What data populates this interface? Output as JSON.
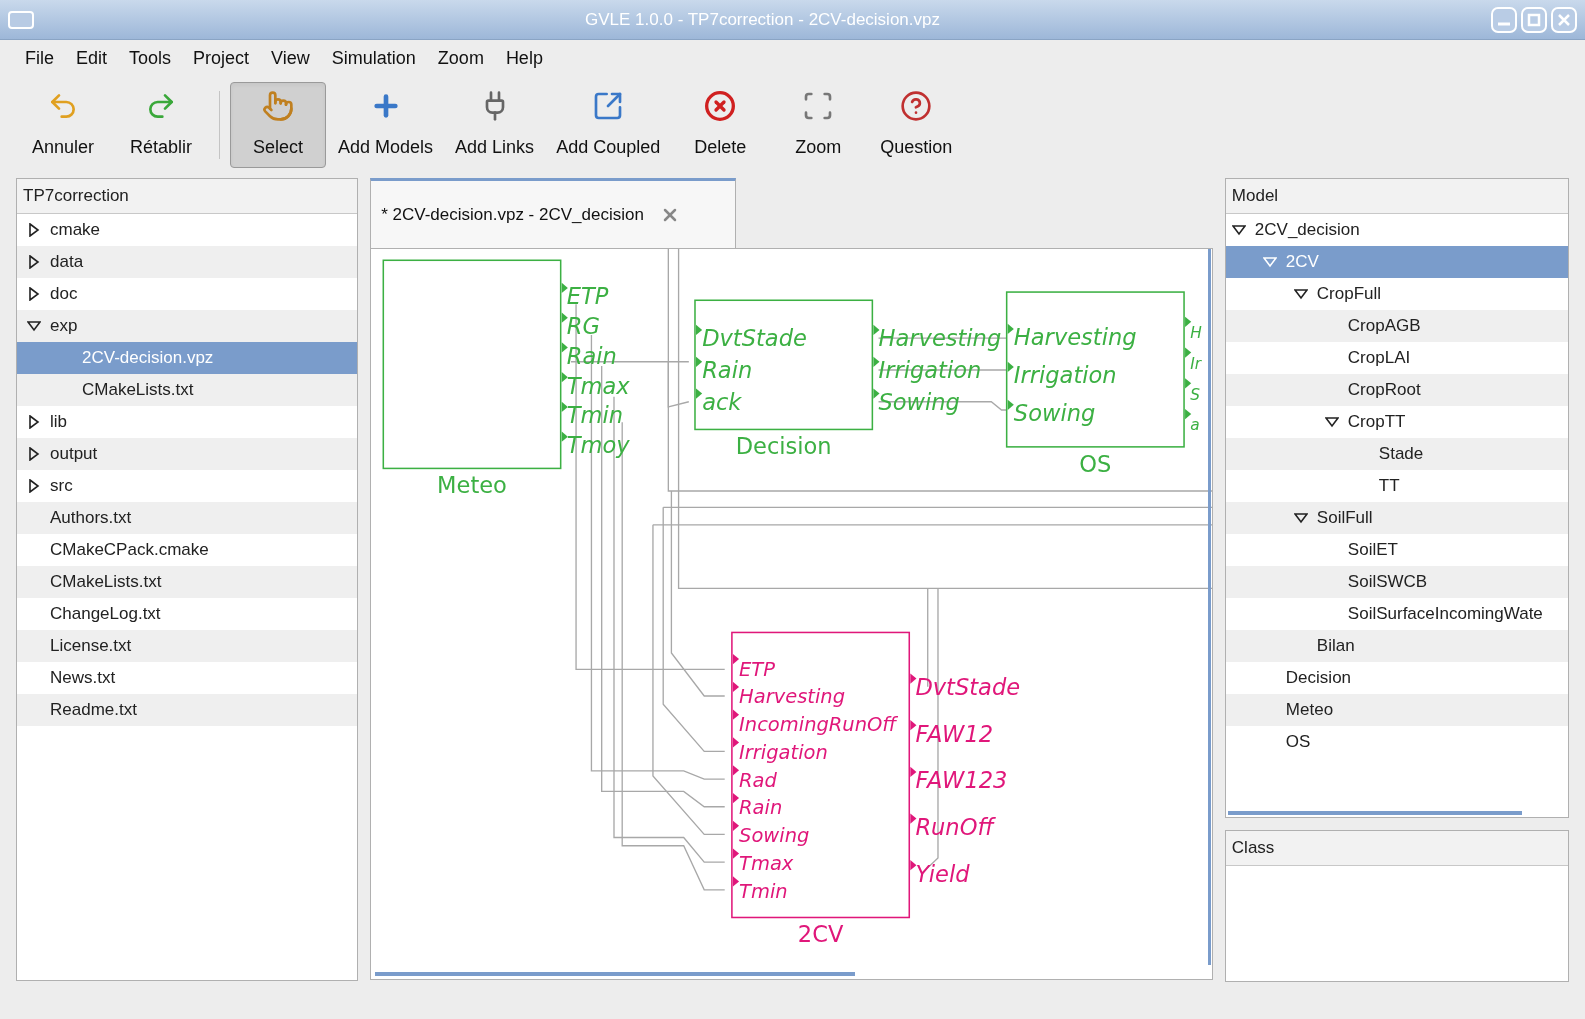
{
  "window": {
    "title": "GVLE 1.0.0 - TP7correction - 2CV-decision.vpz"
  },
  "menu": [
    {
      "label": "File"
    },
    {
      "label": "Edit"
    },
    {
      "label": "Tools"
    },
    {
      "label": "Project"
    },
    {
      "label": "View"
    },
    {
      "label": "Simulation"
    },
    {
      "label": "Zoom"
    },
    {
      "label": "Help"
    }
  ],
  "toolbar": [
    {
      "label": "Annuler",
      "kind": "undo",
      "selected": false
    },
    {
      "label": "Rétablir",
      "kind": "redo",
      "selected": false
    },
    {
      "label": "Select",
      "kind": "select",
      "selected": true
    },
    {
      "label": "Add Models",
      "kind": "add",
      "selected": false
    },
    {
      "label": "Add Links",
      "kind": "plug",
      "selected": false
    },
    {
      "label": "Add Coupled",
      "kind": "coupled",
      "selected": false
    },
    {
      "label": "Delete",
      "kind": "delete",
      "selected": false
    },
    {
      "label": "Zoom",
      "kind": "zoom",
      "selected": false
    },
    {
      "label": "Question",
      "kind": "question",
      "selected": false
    }
  ],
  "project_tree": {
    "title": "TP7correction",
    "items": [
      {
        "label": "cmake",
        "expanded": false,
        "selected": false
      },
      {
        "label": "data",
        "expanded": false,
        "selected": false
      },
      {
        "label": "doc",
        "expanded": false,
        "selected": false
      },
      {
        "label": "exp",
        "expanded": true,
        "selected": false,
        "children": [
          {
            "label": "2CV-decision.vpz",
            "selected": true
          },
          {
            "label": "CMakeLists.txt",
            "selected": false
          }
        ]
      },
      {
        "label": "lib",
        "expanded": false,
        "selected": false
      },
      {
        "label": "output",
        "expanded": false,
        "selected": false
      },
      {
        "label": "src",
        "expanded": false,
        "selected": false
      },
      {
        "label": "Authors.txt",
        "selected": false
      },
      {
        "label": "CMakeCPack.cmake",
        "selected": false
      },
      {
        "label": "CMakeLists.txt",
        "selected": false
      },
      {
        "label": "ChangeLog.txt",
        "selected": false
      },
      {
        "label": "License.txt",
        "selected": false
      },
      {
        "label": "News.txt",
        "selected": false
      },
      {
        "label": "Readme.txt",
        "selected": false
      }
    ]
  },
  "editor": {
    "tab": {
      "label": "* 2CV-decision.vpz - 2CV_decision",
      "selected": true
    },
    "models": [
      {
        "name": "Meteo",
        "color": "#3cb043",
        "outputs": [
          "ETP",
          "RG",
          "Rain",
          "Tmax",
          "Tmin",
          "Tmoy"
        ]
      },
      {
        "name": "Decision",
        "color": "#3cb043",
        "inputs": [
          "DvtStade",
          "Rain",
          "ack"
        ],
        "outputs": [
          "Harvesting",
          "Irrigation",
          "Sowing"
        ]
      },
      {
        "name": "OS",
        "color": "#3cb043",
        "inputs": [
          "Harvesting",
          "Irrigation",
          "Sowing"
        ],
        "outputs": [
          "H",
          "Ir",
          "S",
          "a"
        ]
      },
      {
        "name": "2CV",
        "color": "#e0177a",
        "inputs": [
          "ETP",
          "Harvesting",
          "IncomingRunOff",
          "Irrigation",
          "Rad",
          "Rain",
          "Sowing",
          "Tmax",
          "Tmin"
        ],
        "outputs": [
          "DvtStade",
          "FAW12",
          "FAW123",
          "RunOff",
          "Yield"
        ]
      }
    ]
  },
  "model_tree": {
    "title": "Model",
    "items": [
      {
        "label": "2CV_decision",
        "expanded": true,
        "selected": false,
        "children": [
          {
            "label": "2CV",
            "expanded": true,
            "selected": true,
            "children": [
              {
                "label": "CropFull",
                "expanded": true,
                "selected": false,
                "children": [
                  {
                    "label": "CropAGB",
                    "selected": false
                  },
                  {
                    "label": "CropLAI",
                    "selected": false
                  },
                  {
                    "label": "CropRoot",
                    "selected": false
                  },
                  {
                    "label": "CropTT",
                    "expanded": true,
                    "selected": false,
                    "children": [
                      {
                        "label": "Stade",
                        "selected": false
                      },
                      {
                        "label": "TT",
                        "selected": false
                      }
                    ]
                  }
                ]
              },
              {
                "label": "SoilFull",
                "expanded": true,
                "selected": false,
                "children": [
                  {
                    "label": "SoilET",
                    "selected": false
                  },
                  {
                    "label": "SoilSWCB",
                    "selected": false
                  },
                  {
                    "label": "SoilSurfaceIncomingWate",
                    "selected": false
                  }
                ]
              },
              {
                "label": "Bilan",
                "selected": false
              }
            ]
          },
          {
            "label": "Decision",
            "selected": false
          },
          {
            "label": "Meteo",
            "selected": false
          },
          {
            "label": "OS",
            "selected": false
          }
        ]
      }
    ]
  },
  "class_panel": {
    "title": "Class"
  }
}
